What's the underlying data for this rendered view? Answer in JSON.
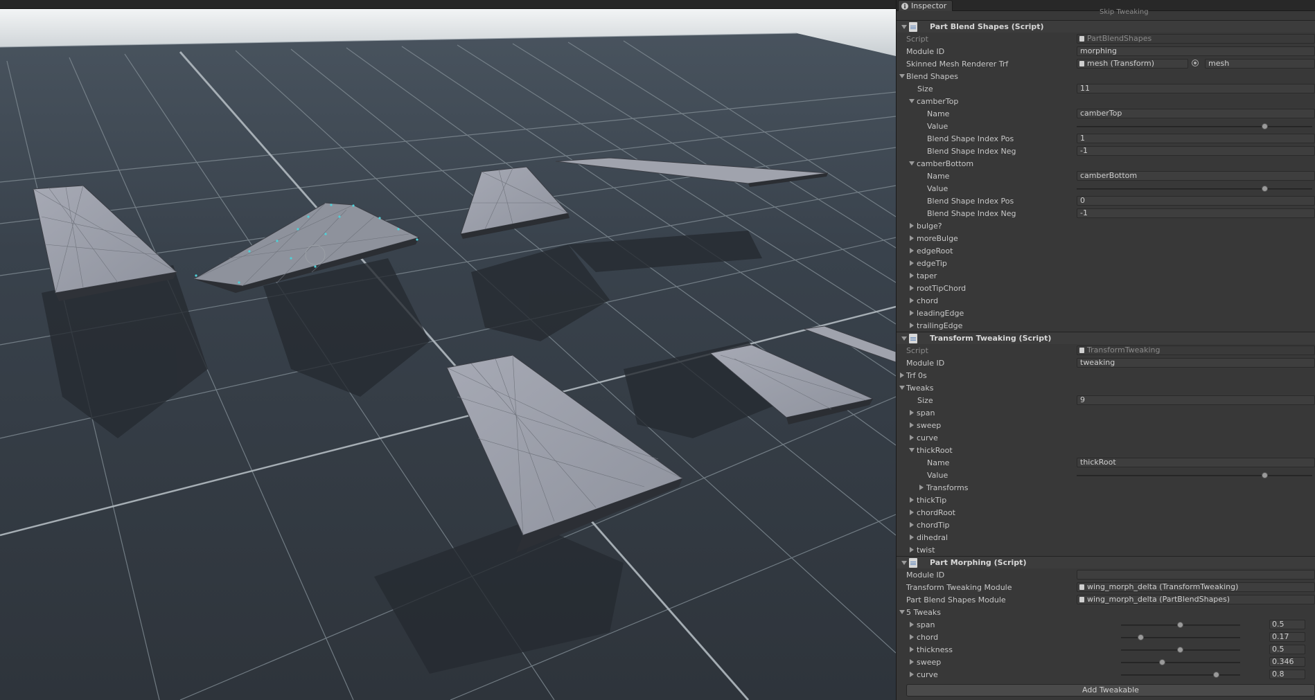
{
  "inspector": {
    "tab_label": "Inspector",
    "scroll_hint": "Skip Tweaking",
    "part_blend_shapes": {
      "title": "Part Blend Shapes (Script)",
      "script_label": "Script",
      "script_value": "PartBlendShapes",
      "module_id_label": "Module ID",
      "module_id_value": "morphing",
      "skinned_label": "Skinned Mesh Renderer Trf",
      "skinned_value": "mesh (Transform)",
      "skinned_value2": "mesh",
      "blend_shapes_label": "Blend Shapes",
      "size_label": "Size",
      "size_value": "11",
      "camber_top": {
        "label": "camberTop",
        "name_label": "Name",
        "name_value": "camberTop",
        "value_label": "Value",
        "value": 0.8,
        "pos_label": "Blend Shape Index Pos",
        "pos_value": "1",
        "neg_label": "Blend Shape Index Neg",
        "neg_value": "-1"
      },
      "camber_bottom": {
        "label": "camberBottom",
        "name_label": "Name",
        "name_value": "camberBottom",
        "value_label": "Value",
        "value": 0.8,
        "pos_label": "Blend Shape Index Pos",
        "pos_value": "0",
        "neg_label": "Blend Shape Index Neg",
        "neg_value": "-1"
      },
      "collapsed_items": [
        "bulge?",
        "moreBulge",
        "edgeRoot",
        "edgeTip",
        "taper",
        "rootTipChord",
        "chord",
        "leadingEdge",
        "trailingEdge"
      ]
    },
    "transform_tweaking": {
      "title": "Transform Tweaking (Script)",
      "script_label": "Script",
      "script_value": "TransformTweaking",
      "module_id_label": "Module ID",
      "module_id_value": "tweaking",
      "trf0s_label": "Trf 0s",
      "tweaks_label": "Tweaks",
      "size_label": "Size",
      "size_value": "9",
      "before_items": [
        "span",
        "sweep",
        "curve"
      ],
      "thick_root": {
        "label": "thickRoot",
        "name_label": "Name",
        "name_value": "thickRoot",
        "value_label": "Value",
        "value": 0.8,
        "transforms_label": "Transforms"
      },
      "after_items": [
        "thickTip",
        "chordRoot",
        "chordTip",
        "dihedral",
        "twist"
      ]
    },
    "part_morphing": {
      "title": "Part Morphing (Script)",
      "module_id_label": "Module ID",
      "module_id_value": "",
      "ttm_label": "Transform Tweaking Module",
      "ttm_value": "wing_morph_delta (TransformTweaking)",
      "pbsm_label": "Part Blend Shapes Module",
      "pbsm_value": "wing_morph_delta (PartBlendShapes)",
      "tweaks_header": "5 Tweaks",
      "tweaks": [
        {
          "name": "span",
          "value": "0.5",
          "level": 0.5
        },
        {
          "name": "chord",
          "value": "0.17",
          "level": 0.17
        },
        {
          "name": "thickness",
          "value": "0.5",
          "level": 0.5
        },
        {
          "name": "sweep",
          "value": "0.346",
          "level": 0.346
        },
        {
          "name": "curve",
          "value": "0.8",
          "level": 0.8
        }
      ],
      "add_button": "Add Tweakable"
    }
  }
}
